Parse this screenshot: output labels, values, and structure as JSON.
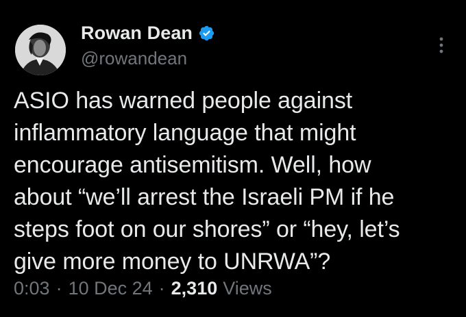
{
  "author": {
    "display_name": "Rowan Dean",
    "handle": "@rowandean",
    "verified": true,
    "verified_color": "#1d9bf0",
    "avatar_icon": "profile-photo"
  },
  "tweet": {
    "text": "ASIO has warned people against\ninflammatory language that might\nencourage antisemitism. Well, how\nabout “we’ll arrest the Israeli PM if he\nsteps foot on our shores” or “hey, let’s\ngive more money to UNRWA”?"
  },
  "meta": {
    "time": "0:03",
    "separator": "·",
    "date": "10 Dec 24",
    "views_count": "2,310",
    "views_label": "Views"
  },
  "colors": {
    "background": "#000000",
    "primary_text": "#e7e9ea",
    "secondary_text": "#71767b"
  }
}
